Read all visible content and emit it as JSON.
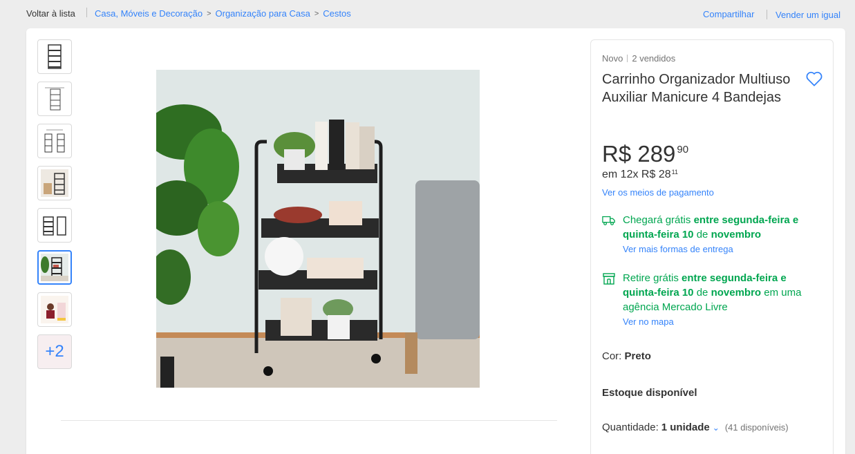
{
  "topbar": {
    "back": "Voltar à lista",
    "breadcrumbs": [
      "Casa, Móveis e Decoração",
      "Organização para Casa",
      "Cestos"
    ],
    "share": "Compartilhar",
    "sell": "Vender um igual"
  },
  "gallery": {
    "thumbnails": [
      "shelf-rack-icon",
      "spec-sheet-icon",
      "dimension-sheet-icon",
      "room-scene-icon",
      "rack-outline-icon",
      "rack-photo-icon",
      "promo-icon",
      "more-icon"
    ],
    "more_label": "+2",
    "active_index": 5
  },
  "product": {
    "condition": "Novo",
    "sold": "2 vendidos",
    "title": "Carrinho Organizador Multiuso Auxiliar Manicure 4 Bandejas",
    "price_int": "R$ 289",
    "price_cents": "90",
    "installments_prefix": "em 12x R$ 28",
    "installments_cents": "11",
    "payment_link": "Ver os meios de pagamento"
  },
  "shipping": {
    "delivery_prefix": "Chegará grátis ",
    "delivery_bold": "entre segunda-feira e quinta-feira 10",
    "delivery_mid": " de ",
    "delivery_month": "novembro",
    "delivery_link": "Ver mais formas de entrega",
    "pickup_prefix": "Retire grátis ",
    "pickup_bold": "entre segunda-feira e quinta-feira 10",
    "pickup_mid": " de ",
    "pickup_month": "novembro",
    "pickup_suffix": " em uma agência Mercado Livre",
    "pickup_link": "Ver no mapa"
  },
  "options": {
    "color_label": "Cor: ",
    "color_value": "Preto",
    "stock": "Estoque disponível",
    "qty_label": "Quantidade: ",
    "qty_value": "1 unidade",
    "qty_available": "(41 disponíveis)"
  },
  "colors": {
    "accent": "#3483fa",
    "green": "#00a650",
    "background": "#ededed"
  }
}
